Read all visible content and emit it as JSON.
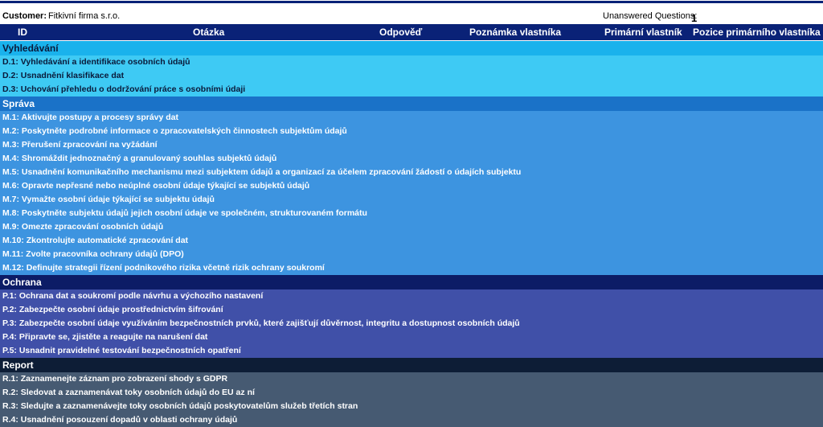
{
  "header": {
    "customer_label": "Customer:",
    "customer_value": "Fitkivní firma s.r.o.",
    "unanswered_label": "Unanswered Questions:",
    "unanswered_value": "1"
  },
  "columns": [
    "ID",
    "Otázka",
    "Odpověď",
    "Poznámka vlastníka",
    "Primární vlastník",
    "Pozice primárního vlastníka"
  ],
  "sections": [
    {
      "title": "Vyhledávání",
      "rows": [
        "D.1: Vyhledávání a identifikace osobních údajů",
        "D.2: Usnadnění klasifikace dat",
        "D.3: Uchování přehledu o dodržování práce s osobními údaji"
      ]
    },
    {
      "title": "Správa",
      "rows": [
        "M.1: Aktivujte postupy a procesy správy dat",
        "M.2: Poskytněte podrobné informace o zpracovatelských činnostech subjektům údajů",
        "M.3: Přerušení zpracování na vyžádání",
        "M.4: Shromáždit jednoznačný a granulovaný souhlas subjektů údajů",
        "M.5: Usnadnění komunikačního mechanismu mezi subjektem údajů a organizací za účelem zpracování žádostí o údajích subjektu",
        "M.6: Opravte nepřesné nebo neúplné osobní údaje týkající se subjektů údajů",
        "M.7: Vymažte osobní údaje týkající se subjektu údajů",
        "M.8: Poskytněte subjektu údajů jejich osobní údaje ve společném, strukturovaném formátu",
        "M.9: Omezte zpracování osobních údajů",
        "M.10: Zkontrolujte automatické zpracování dat",
        "M.11: Zvolte pracovníka ochrany údajů (DPO)",
        "M.12: Definujte strategii řízení podnikového rizika včetně rizik ochrany soukromí"
      ]
    },
    {
      "title": "Ochrana",
      "rows": [
        "P.1: Ochrana dat a soukromí podle návrhu a výchozího nastavení",
        "P.2: Zabezpečte osobní údaje prostřednictvím šifrování",
        "P.3: Zabezpečte osobní údaje využíváním bezpečnostních prvků, které zajišťují důvěrnost, integritu a dostupnost osobních údajů",
        "P.4: Připravte se, zjistěte a reagujte na narušení dat",
        "P.5: Usnadnit pravidelné testování bezpečnostních opatření"
      ]
    },
    {
      "title": "Report",
      "rows": [
        "R.1: Zaznamenejte záznam pro zobrazení shody s GDPR",
        "R.2: Sledovat a zaznamenávat toky osobních údajů do EU az ní",
        "R.3: Sledujte a zaznamenávejte toky osobních údajů poskytovatelům služeb třetích stran",
        "R.4: Usnadnění posouzení dopadů v oblasti ochrany údajů"
      ]
    }
  ]
}
